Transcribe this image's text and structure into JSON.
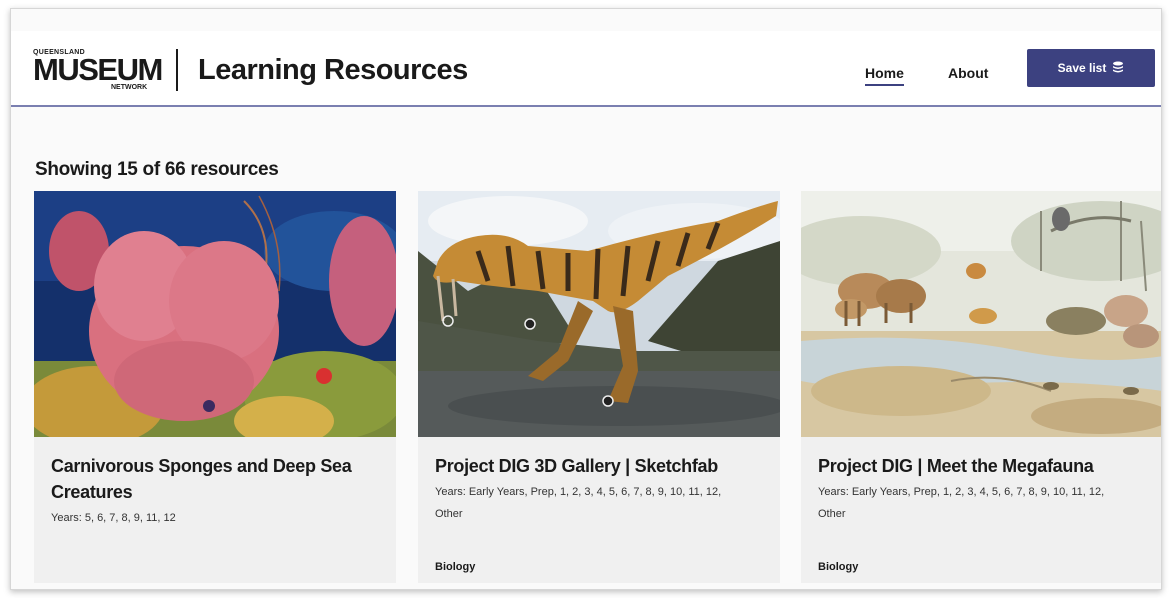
{
  "header": {
    "logo_top": "QUEENSLAND",
    "logo_main": "MUSEUM",
    "logo_bottom": "NETWORK",
    "site_title": "Learning Resources",
    "nav": [
      {
        "label": "Home",
        "active": true
      },
      {
        "label": "About",
        "active": false
      }
    ],
    "save_label": "Save list",
    "save_icon": "list-stack-icon"
  },
  "results": {
    "showing": "Showing 15 of 66 resources"
  },
  "cards": [
    {
      "title": "Carnivorous Sponges and Deep Sea Creatures",
      "years": "Years: 5, 6, 7, 8, 9, 11, 12",
      "subject": ""
    },
    {
      "title": "Project DIG 3D Gallery | Sketchfab",
      "years": "Years: Early Years, Prep, 1, 2, 3, 4, 5, 6, 7, 8, 9, 10, 11, 12, Other",
      "subject": "Biology"
    },
    {
      "title": "Project DIG | Meet the Megafauna",
      "years": "Years: Early Years, Prep, 1, 2, 3, 4, 5, 6, 7, 8, 9, 10, 11, 12, Other",
      "subject": "Biology"
    }
  ],
  "colors": {
    "accent": "#3c4180",
    "header_rule": "#7a7fb0",
    "card_bg": "#f0f0f0"
  }
}
